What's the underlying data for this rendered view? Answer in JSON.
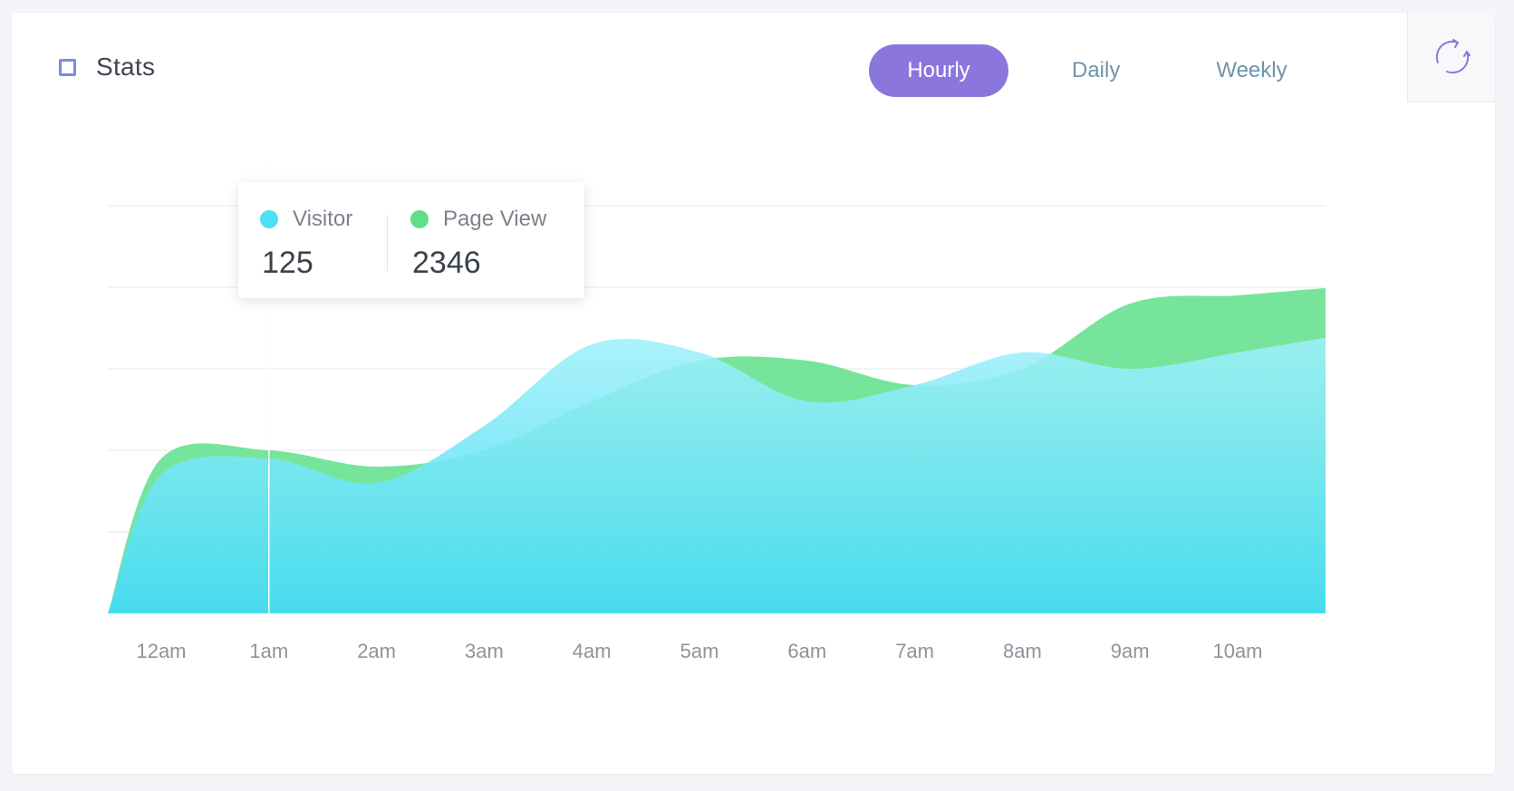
{
  "header": {
    "title": "Stats",
    "tabs": [
      {
        "label": "Hourly",
        "active": true
      },
      {
        "label": "Daily",
        "active": false
      },
      {
        "label": "Weekly",
        "active": false
      }
    ]
  },
  "colors": {
    "visitor": "#4fdff2",
    "page_view": "#5ee08a",
    "accent": "#8a76dd"
  },
  "tooltip": {
    "x": "1am",
    "visitor_label": "Visitor",
    "visitor_value": "125",
    "page_view_label": "Page View",
    "page_view_value": "2346"
  },
  "chart_data": {
    "type": "area",
    "title": "Stats",
    "categories": [
      "12am",
      "1am",
      "2am",
      "3am",
      "4am",
      "5am",
      "6am",
      "7am",
      "8am",
      "9am",
      "10am"
    ],
    "series": [
      {
        "name": "Visitor",
        "values": [
          1.7,
          1.9,
          1.6,
          2.3,
          3.3,
          3.2,
          2.6,
          2.8,
          3.2,
          3.0,
          3.2
        ]
      },
      {
        "name": "Page View",
        "values": [
          1.9,
          2.0,
          1.8,
          2.0,
          2.6,
          3.1,
          3.1,
          2.8,
          3.0,
          3.8,
          3.9
        ]
      }
    ],
    "ylim": [
      0,
      5
    ],
    "grid": true
  }
}
